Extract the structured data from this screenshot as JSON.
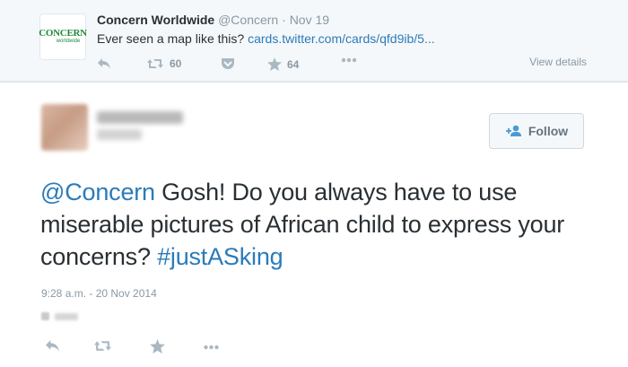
{
  "parent_tweet": {
    "logo_text": "CONCERN",
    "logo_subtext": "worldwide",
    "author_name": "Concern Worldwide",
    "author_handle": "@Concern",
    "separator": "·",
    "date": "Nov 19",
    "text": "Ever seen a map like this?",
    "link": "cards.twitter.com/cards/qfd9ib/5...",
    "retweet_count": "60",
    "favorite_count": "64",
    "view_details": "View details",
    "icons": [
      "reply-icon",
      "retweet-icon",
      "pocket-icon",
      "favorite-icon",
      "more-icon"
    ]
  },
  "main_tweet": {
    "follow_label": "Follow",
    "mention": "@Concern",
    "body": " Gosh! Do you always have to use miserable pictures of African child to express your concerns? ",
    "hashtag": "#justASking",
    "timestamp": "9:28 a.m. - 20 Nov 2014",
    "icons": [
      "reply-icon",
      "retweet-icon",
      "favorite-icon",
      "more-icon"
    ]
  },
  "colors": {
    "link": "#2b7bb9",
    "muted": "#8899a6",
    "icon": "#aab8c2",
    "brand_green": "#1f8a3a"
  }
}
